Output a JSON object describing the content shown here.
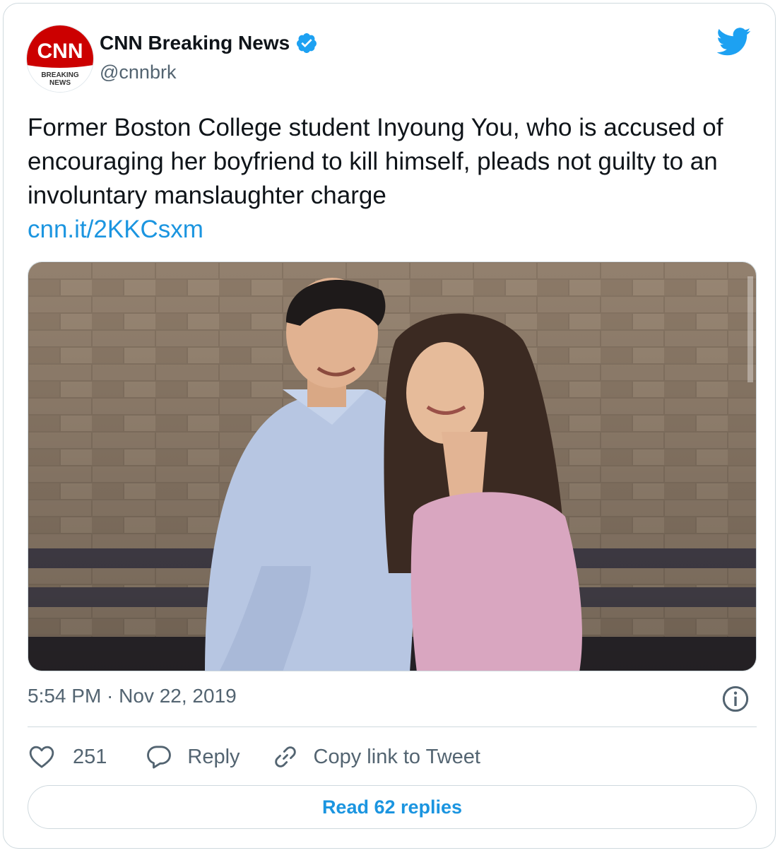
{
  "tweet": {
    "author": {
      "name": "CNN Breaking News",
      "handle": "@cnnbrk",
      "verified": true,
      "avatar": {
        "logo_text": "CNN",
        "subtitle_line1": "BREAKING",
        "subtitle_line2": "NEWS"
      }
    },
    "text": "Former Boston College student Inyoung You, who is accused of encouraging her boyfriend to kill himself, pleads not guilty to an involuntary manslaughter charge",
    "link": "cnn.it/2KKCsxm",
    "timestamp": "5:54 PM · Nov 22, 2019",
    "actions": {
      "likes_count": "251",
      "reply_label": "Reply",
      "copy_link_label": "Copy link to Tweet"
    },
    "read_replies_label": "Read 62 replies"
  },
  "icons": {
    "brand": "twitter-bird-icon",
    "verified": "verified-badge-icon",
    "info": "info-icon",
    "like": "heart-icon",
    "reply": "reply-bubble-icon",
    "copy_link": "link-icon"
  },
  "colors": {
    "brand_blue": "#1da1f2",
    "link_blue": "#1b95e0",
    "cnn_red": "#cc0000",
    "secondary_text": "#536471",
    "border": "#cfd9de"
  }
}
